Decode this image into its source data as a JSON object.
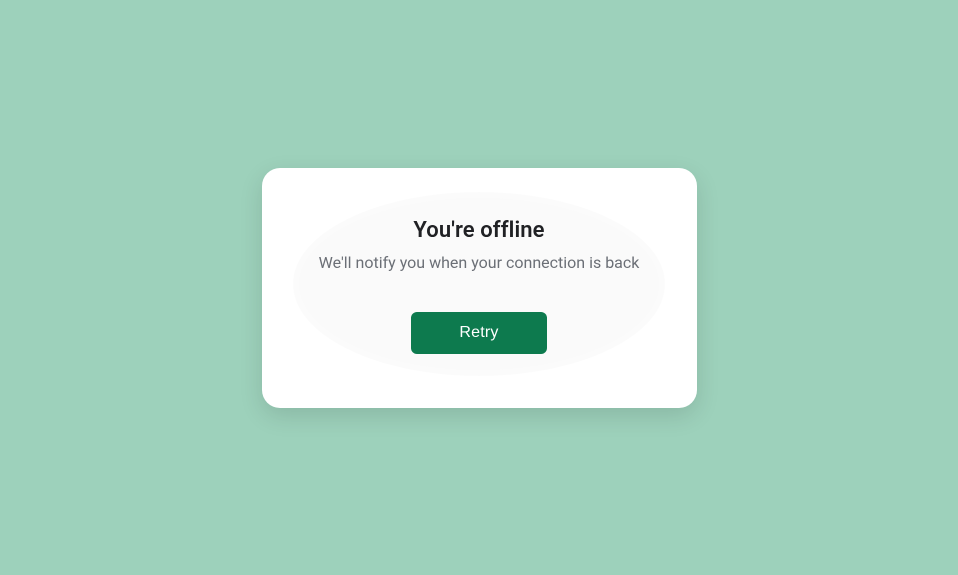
{
  "modal": {
    "title": "You're offline",
    "subtitle": "We'll notify you when your connection is back",
    "retry_label": "Retry"
  },
  "colors": {
    "page_bg": "#9dd1bb",
    "card_bg": "#ffffff",
    "title_text": "#202124",
    "subtitle_text": "#6b6f76",
    "button_bg": "#0d7a4e",
    "button_text": "#ffffff"
  }
}
